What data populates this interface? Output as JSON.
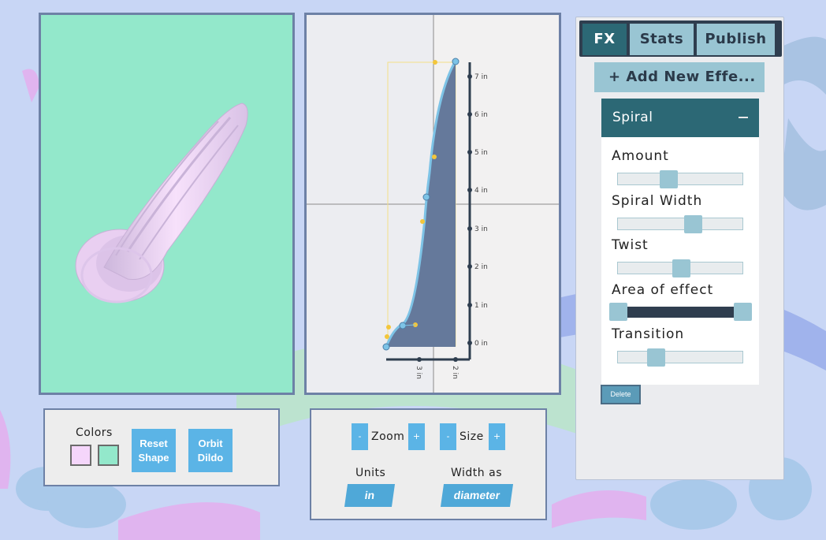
{
  "colors_panel": {
    "label": "Colors",
    "swatch_primary": "#f5d6fb",
    "swatch_secondary": "#93e8cb",
    "reset_button": [
      "Reset",
      "Shape"
    ],
    "orbit_button": [
      "Orbit",
      "Dildo"
    ]
  },
  "view_panel": {
    "zoom_minus": "-",
    "zoom_label": "Zoom",
    "zoom_plus": "+",
    "size_minus": "-",
    "size_label": "Size",
    "size_plus": "+",
    "units_label": "Units",
    "units_value": "in",
    "width_as_label": "Width as",
    "width_as_value": "diameter"
  },
  "editor": {
    "height_ticks": [
      "7 in",
      "6 in",
      "5 in",
      "4 in",
      "3 in",
      "2 in",
      "1 in",
      "0 in"
    ],
    "width_ticks": [
      "3 in",
      "2 in"
    ]
  },
  "fx_panel": {
    "tabs": [
      "FX",
      "Stats",
      "Publish"
    ],
    "active_tab": "FX",
    "add_effect_label": "+ Add New Effe...",
    "effect": {
      "name": "Spiral",
      "params": [
        {
          "label": "Amount",
          "value": 0.4
        },
        {
          "label": "Spiral Width",
          "value": 0.6
        },
        {
          "label": "Twist",
          "value": 0.5
        },
        {
          "label": "Transition",
          "value": 0.3
        }
      ],
      "area_label": "Area of effect",
      "area_range": [
        0,
        1
      ]
    },
    "delete_label": "Delete"
  },
  "colors": {
    "accent": "#5bb4e6",
    "tab_active": "#2c6875",
    "tab_inactive": "#99c5d3",
    "preview_bg": "#93e8cb",
    "shape_fill": "#f1cdf7",
    "profile_fill": "#65799b",
    "profile_stroke": "#7dc3e6",
    "control_point": "#f3c63b"
  }
}
